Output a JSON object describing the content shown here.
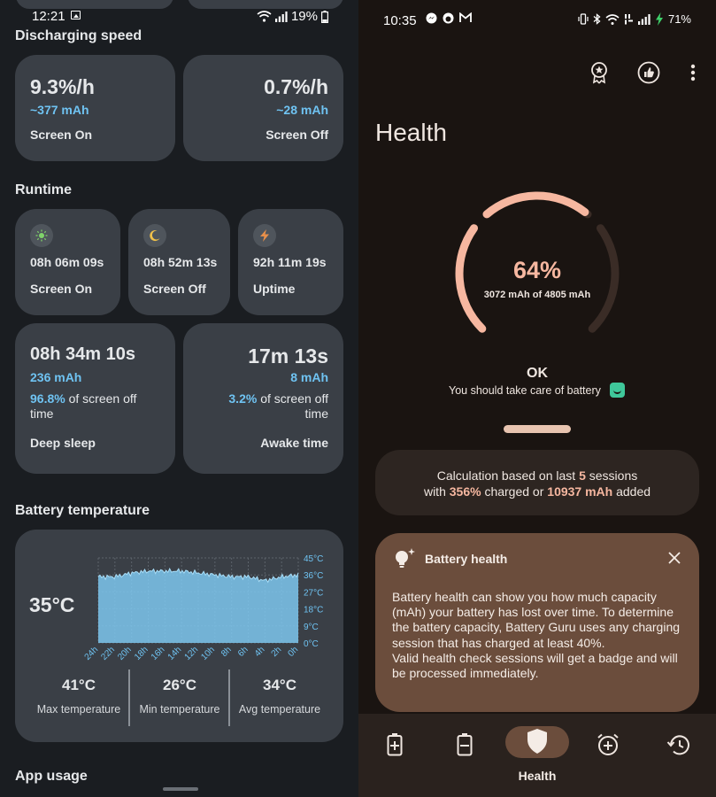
{
  "left": {
    "status": {
      "time": "12:21",
      "battery": "19%"
    },
    "discharging": {
      "title": "Discharging speed",
      "on": {
        "rate": "9.3%/h",
        "mah": "~377 mAh",
        "label": "Screen On"
      },
      "off": {
        "rate": "0.7%/h",
        "mah": "~28 mAh",
        "label": "Screen Off"
      }
    },
    "runtime": {
      "title": "Runtime",
      "items": [
        {
          "value": "08h 06m 09s",
          "label": "Screen On",
          "icon": "sun-icon",
          "color": "#7fd36a"
        },
        {
          "value": "08h 52m 13s",
          "label": "Screen Off",
          "icon": "moon-icon",
          "color": "#f1c14a"
        },
        {
          "value": "92h 11m 19s",
          "label": "Uptime",
          "icon": "bolt-icon",
          "color": "#e8904a"
        }
      ],
      "deep": {
        "time": "08h 34m 10s",
        "mah": "236 mAh",
        "pct": "96.8%",
        "pct_text": " of screen off time",
        "label": "Deep sleep"
      },
      "awake": {
        "time": "17m 13s",
        "mah": "8 mAh",
        "pct": "3.2%",
        "pct_text": " of screen off time",
        "label": "Awake time"
      }
    },
    "temperature": {
      "title": "Battery temperature",
      "current": "35°C",
      "y_ticks": [
        "45°C",
        "36°C",
        "27°C",
        "18°C",
        "9°C",
        "0°C"
      ],
      "x_ticks": [
        "24h",
        "22h",
        "20h",
        "18h",
        "16h",
        "14h",
        "12h",
        "10h",
        "8h",
        "6h",
        "4h",
        "2h",
        "0h"
      ],
      "stats": [
        {
          "value": "41°C",
          "label": "Max temperature"
        },
        {
          "value": "26°C",
          "label": "Min temperature"
        },
        {
          "value": "34°C",
          "label": "Avg temperature"
        }
      ]
    },
    "app_usage_title": "App usage"
  },
  "chart_data": {
    "type": "area",
    "title": "",
    "xlabel": "",
    "ylabel": "",
    "x": [
      "24h",
      "22h",
      "20h",
      "18h",
      "16h",
      "14h",
      "12h",
      "10h",
      "8h",
      "6h",
      "4h",
      "2h",
      "0h"
    ],
    "y": [
      35,
      35,
      37,
      38,
      38,
      38,
      37,
      36,
      35,
      35,
      33,
      35,
      36
    ],
    "ylim": [
      0,
      45
    ],
    "grid": true,
    "color": "#7ec7ef"
  },
  "right": {
    "status": {
      "time": "10:35",
      "battery": "71%"
    },
    "title": "Health",
    "gauge": {
      "percent": 64,
      "percent_text": "64%",
      "sub": "3072 mAh of 4805 mAh",
      "fill_color": "#f6b7a0",
      "track_color": "#3a2c26"
    },
    "state": "OK",
    "advice": "You should take care of battery",
    "calc": {
      "prefix": "Calculation based on last ",
      "sessions": "5",
      "mid1": " sessions",
      "with": "with ",
      "charged": "356%",
      "mid2": " charged or ",
      "added": "10937 mAh",
      "suffix": " added"
    },
    "info": {
      "title": "Battery health",
      "body": "Battery health can show you how much capacity (mAh) your battery has lost over time. To determine the battery capacity, Battery Guru uses any charging session that has charged at least 40%.\nValid health check sessions will get a badge and will be processed immediately."
    },
    "nav": {
      "active_label": "Health"
    }
  }
}
